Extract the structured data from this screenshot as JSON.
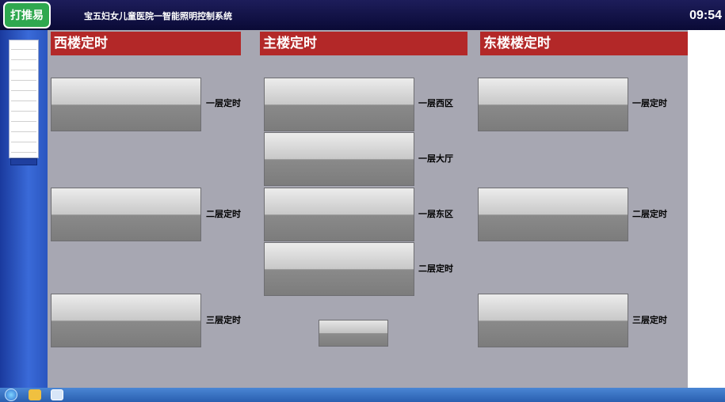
{
  "app": {
    "logo_text": "打推易",
    "title": "宝五妇女儿童医院一智能照明控制系统",
    "clock": "09:54"
  },
  "left_panel": {
    "items": [
      "",
      "",
      "",
      "",
      "",
      "",
      "",
      "",
      "",
      "",
      ""
    ],
    "button_label": ""
  },
  "sections": [
    {
      "header": "西楼定时",
      "rows": [
        {
          "panel_label": "",
          "zone_label": "一层定时"
        },
        {
          "panel_label": "",
          "zone_label": "二层定时"
        },
        {
          "panel_label": "",
          "zone_label": "三层定时"
        }
      ]
    },
    {
      "header": "主楼定时",
      "rows": [
        {
          "panel_label": "",
          "zone_label": "一层西区"
        },
        {
          "panel_label": "",
          "zone_label": "一层大厅"
        },
        {
          "panel_label": "",
          "zone_label": "一层东区"
        },
        {
          "panel_label": "",
          "zone_label": "二层定时"
        }
      ]
    },
    {
      "header": "东楼楼定时",
      "rows": [
        {
          "panel_label": "",
          "zone_label": "一层定时"
        },
        {
          "panel_label": "",
          "zone_label": "二层定时"
        },
        {
          "panel_label": "",
          "zone_label": "三层定时"
        }
      ]
    }
  ],
  "demo_button": {
    "label": ""
  },
  "taskbar": {
    "tray_text": ""
  },
  "colors": {
    "title_bar": "#0a0a36",
    "left_panel": "#2a56c0",
    "work_area": "#a7a7b2",
    "section_header": "#b32828",
    "logo_green": "#2fa84f",
    "taskbar": "#2a5fb0"
  }
}
